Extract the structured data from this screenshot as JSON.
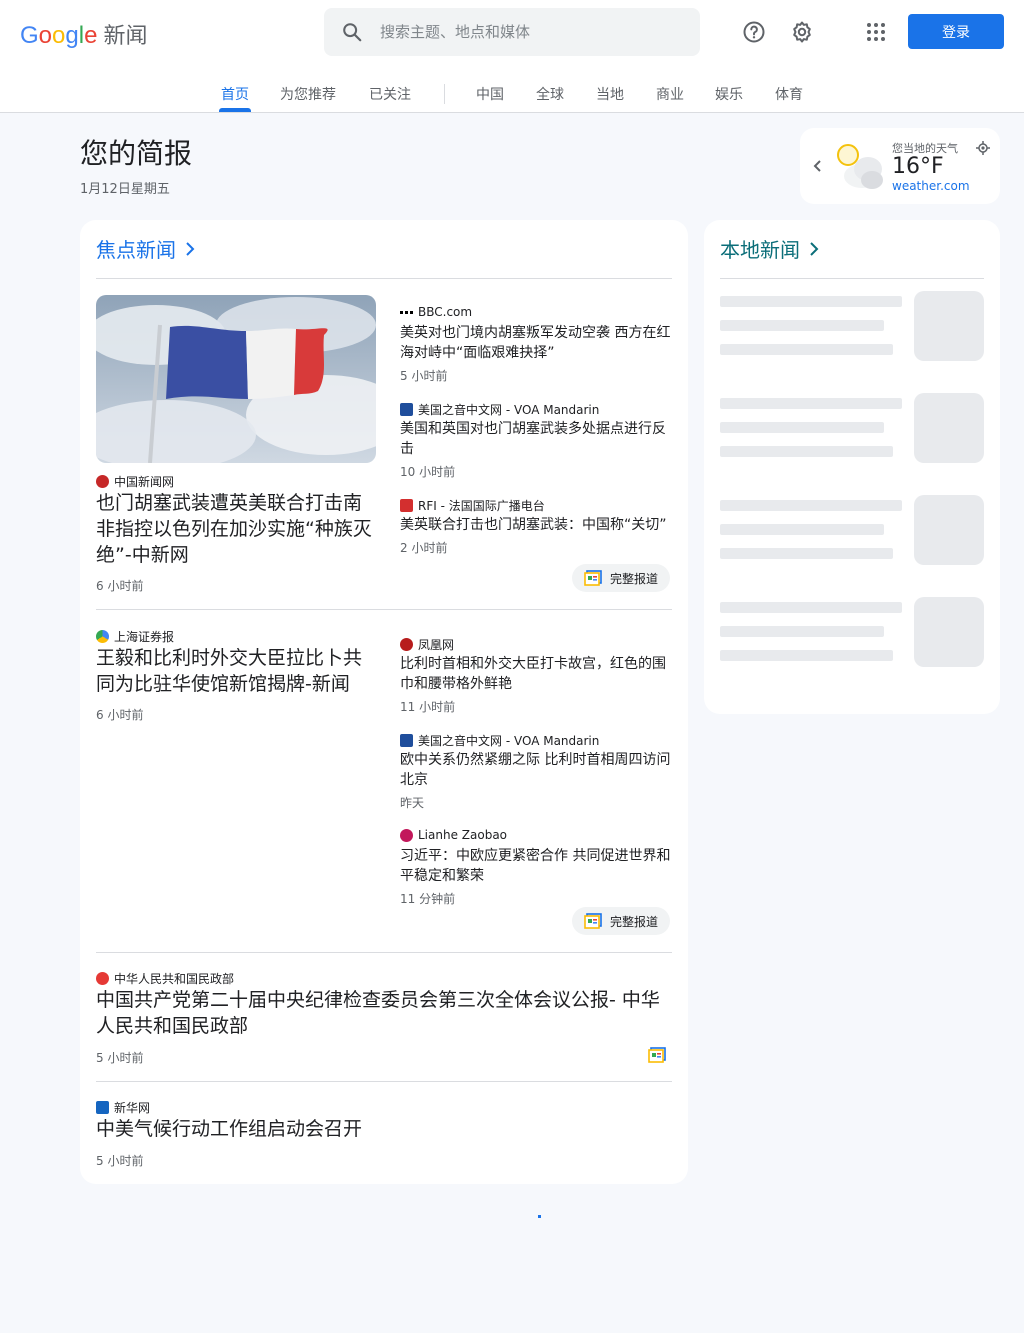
{
  "app": {
    "brand_letters": [
      "G",
      "o",
      "o",
      "g",
      "l",
      "e"
    ],
    "brand_colors": [
      "#4285f4",
      "#ea4335",
      "#fbbc05",
      "#4285f4",
      "#34a853",
      "#ea4335"
    ],
    "product": "新闻"
  },
  "search": {
    "placeholder": "搜索主题、地点和媒体"
  },
  "header": {
    "signin_label": "登录",
    "accent": "#1a73e8"
  },
  "nav": {
    "tabs": [
      {
        "label": "首页",
        "active": true
      },
      {
        "label": "为您推荐"
      },
      {
        "label": "已关注"
      },
      {
        "label": "中国"
      },
      {
        "label": "全球"
      },
      {
        "label": "当地"
      },
      {
        "label": "商业"
      },
      {
        "label": "娱乐"
      },
      {
        "label": "体育"
      }
    ]
  },
  "briefing": {
    "title": "您的简报",
    "date": "1月12日星期五"
  },
  "weather": {
    "label": "您当地的天气",
    "temp": "16°F",
    "source": "weather.com"
  },
  "top_stories": {
    "heading": "焦点新闻",
    "full_coverage_label": "完整报道",
    "clusters": [
      {
        "main": {
          "source": "中国新闻网",
          "title": "也门胡塞武装遭英美联合打击南非指控以色列在加沙实施“种族灭绝”-中新网",
          "time": "6 小时前"
        },
        "related": [
          {
            "source": "BBC.com",
            "title": "美英对也门境内胡塞叛军发动空袭 西方在红海对峙中“面临艰难抉择”",
            "time": "5 小时前"
          },
          {
            "source": "美国之音中文网 - VOA Mandarin",
            "title": "美国和英国对也门胡塞武装多处据点进行反击",
            "time": "10 小时前"
          },
          {
            "source": "RFI - 法国国际广播电台",
            "title": "美英联合打击也门胡塞武装：中国称“关切”",
            "time": "2 小时前"
          }
        ]
      },
      {
        "main": {
          "source": "上海证券报",
          "title": "王毅和比利时外交大臣拉比卜共同为比驻华使馆新馆揭牌-新闻",
          "time": "6 小时前"
        },
        "related": [
          {
            "source": "凤凰网",
            "title": "比利时首相和外交大臣打卡故宫，红色的围巾和腰带格外鲜艳",
            "time": "11 小时前"
          },
          {
            "source": "美国之音中文网 - VOA Mandarin",
            "title": "欧中关系仍然紧绷之际 比利时首相周四访问北京",
            "time": "昨天"
          },
          {
            "source": "Lianhe Zaobao",
            "title": "习近平：中欧应更紧密合作 共同促进世界和平稳定和繁荣",
            "time": "11 分钟前"
          }
        ]
      }
    ],
    "single": [
      {
        "source": "中华人民共和国民政部",
        "title": "中国共产党第二十届中央纪律检查委员会第三次全体会议公报- 中华人民共和国民政部",
        "time": "5 小时前"
      },
      {
        "source": "新华网",
        "title": "中美气候行动工作组启动会召开",
        "time": "5 小时前"
      }
    ]
  },
  "local": {
    "heading": "本地新闻"
  }
}
